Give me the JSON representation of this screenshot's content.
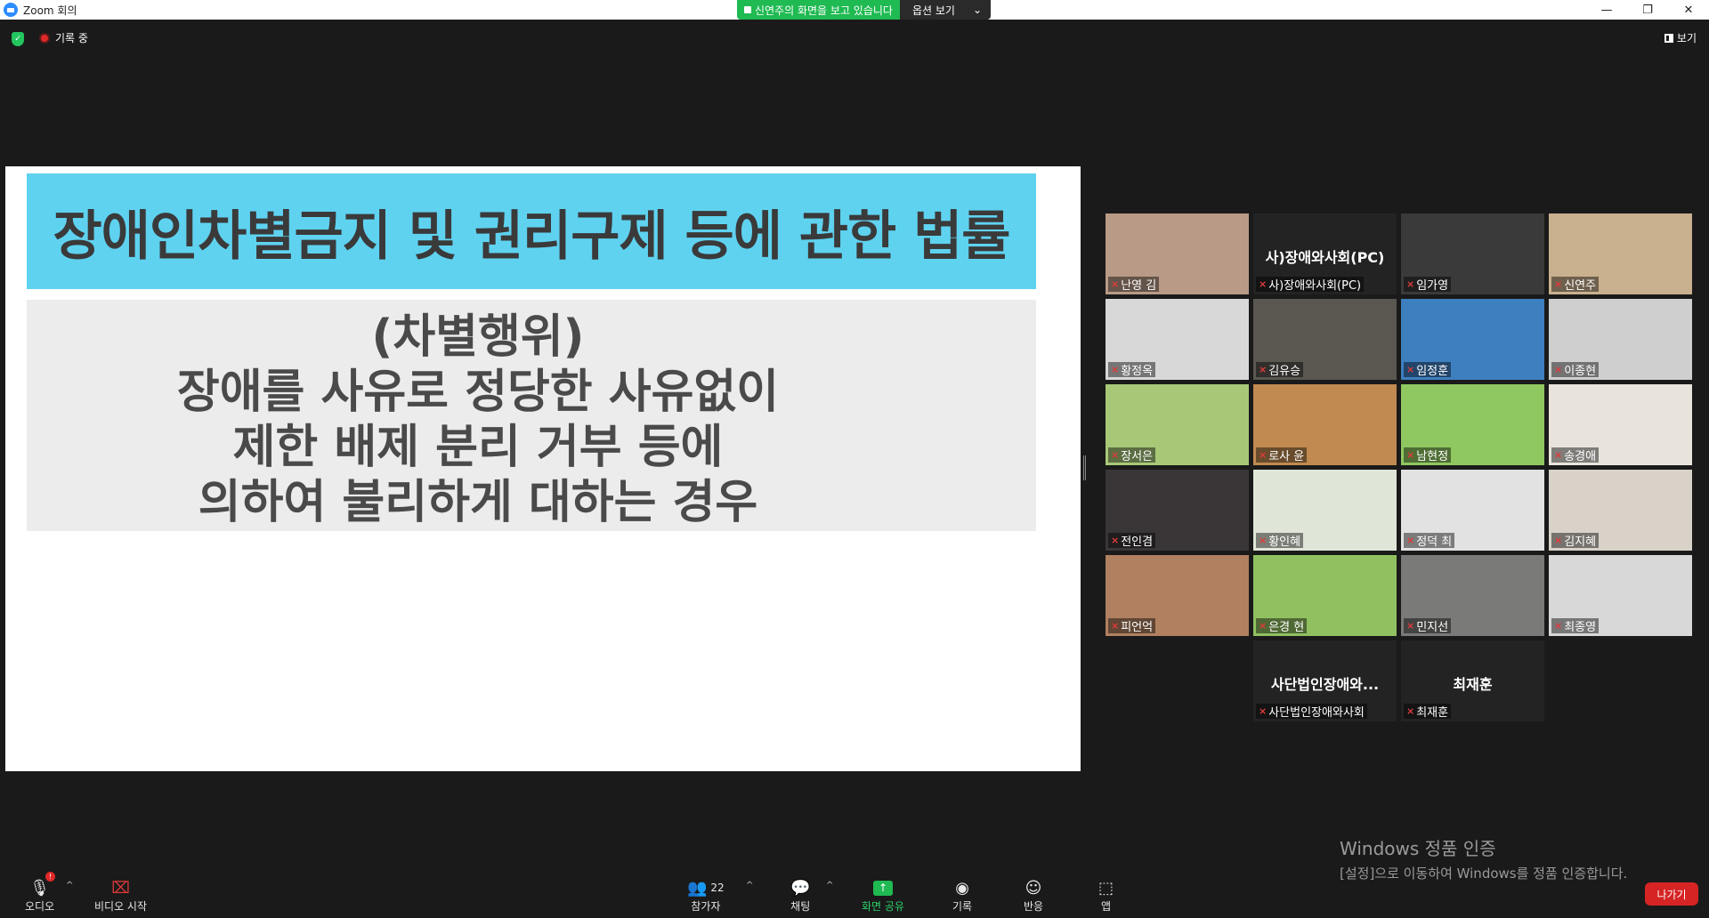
{
  "window": {
    "title": "Zoom 회의",
    "minimize": "—",
    "maximize": "❐",
    "close": "✕"
  },
  "share_banner": {
    "status": "신연주의 화면을 보고 있습니다",
    "options": "옵션 보기",
    "chevron": "⌄"
  },
  "topbar": {
    "recording": "기록 중",
    "view": "보기"
  },
  "slide": {
    "title": "장애인차별금지 및 권리구제 등에 관한 법률",
    "lines": [
      "(차별행위)",
      "장애를 사유로 정당한 사유없이",
      "제한 배제 분리 거부 등에",
      "의하여 불리하게 대하는 경우"
    ]
  },
  "participants": [
    {
      "name": "난영 김",
      "color": "#b89a86"
    },
    {
      "name": "사)장애와사회(PC)",
      "center": "사)장애와사회(PC)",
      "color": "#232323"
    },
    {
      "name": "임가영",
      "color": "#3a3a3a"
    },
    {
      "name": "신연주",
      "color": "#c9b08e",
      "active": true
    },
    {
      "name": "황정옥",
      "color": "#d8d8d8"
    },
    {
      "name": "김유승",
      "color": "#5a5650"
    },
    {
      "name": "임정훈",
      "color": "#3e7fc0"
    },
    {
      "name": "이종현",
      "color": "#cfcfcf"
    },
    {
      "name": "장서은",
      "color": "#a8c878"
    },
    {
      "name": "로사 윤",
      "color": "#c08a50"
    },
    {
      "name": "남현정",
      "color": "#8fc860"
    },
    {
      "name": "송경애",
      "color": "#e8e4dc"
    },
    {
      "name": "전인겸",
      "color": "#3a3638"
    },
    {
      "name": "황인혜",
      "color": "#dfe6d8"
    },
    {
      "name": "정덕 최",
      "color": "#e2e2e2"
    },
    {
      "name": "김지혜",
      "color": "#d8d2c8"
    },
    {
      "name": "피언억",
      "color": "#b08060"
    },
    {
      "name": "은경 현",
      "color": "#90c060"
    },
    {
      "name": "민지선",
      "color": "#7a7a78"
    },
    {
      "name": "최종영",
      "color": "#d8d8d8"
    },
    {
      "name": "사단법인장애와사회",
      "center": "사단법인장애와...",
      "color": "#232323"
    },
    {
      "name": "최재훈",
      "center": "최재훈",
      "color": "#232323"
    }
  ],
  "watermark": {
    "line1": "Windows 정품 인증",
    "line2": "[설정]으로 이동하여 Windows를 정품 인증합니다."
  },
  "toolbar": {
    "audio": "오디오",
    "audio_badge": "!",
    "video": "비디오 시작",
    "participants": "참가자",
    "participants_count": "22",
    "chat": "채팅",
    "share": "화면 공유",
    "record": "기록",
    "reactions": "반응",
    "apps": "앱",
    "leave": "나가기"
  }
}
